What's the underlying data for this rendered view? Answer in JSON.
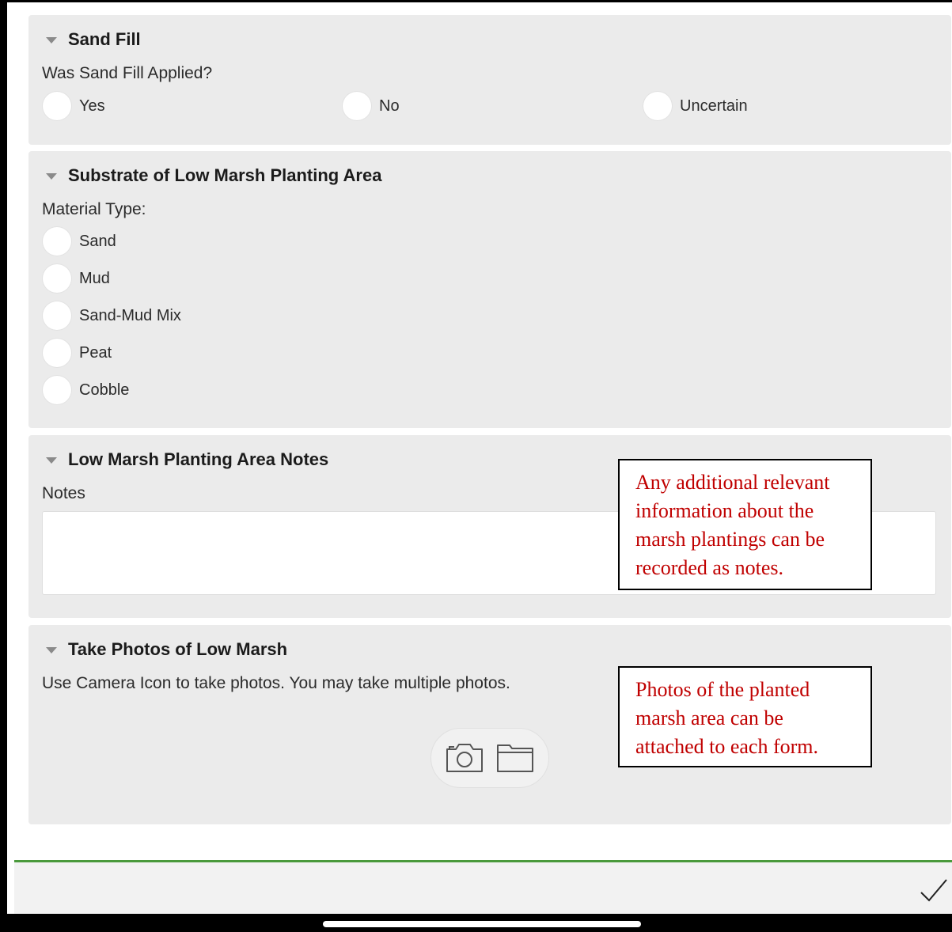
{
  "sections": {
    "sand_fill": {
      "title": "Sand Fill",
      "question": "Was Sand Fill Applied?",
      "options": [
        "Yes",
        "No",
        "Uncertain"
      ]
    },
    "substrate": {
      "title": "Substrate of Low Marsh Planting Area",
      "question": "Material Type:",
      "options": [
        "Sand",
        "Mud",
        "Sand-Mud Mix",
        "Peat",
        "Cobble"
      ]
    },
    "notes": {
      "title": "Low Marsh Planting Area Notes",
      "label": "Notes",
      "value": ""
    },
    "photos": {
      "title": "Take Photos of Low Marsh",
      "instruction": "Use Camera Icon to take photos. You may take multiple photos.",
      "icons": [
        "camera-icon",
        "folder-icon"
      ]
    }
  },
  "callouts": {
    "notes": "Any additional relevant information about the marsh plantings can be recorded as notes.",
    "photos": "Photos of the planted marsh area can be attached to each form."
  },
  "footer": {
    "submit_icon": "checkmark-icon"
  },
  "colors": {
    "section_bg": "#ebebeb",
    "accent_green": "#4a9a3c",
    "callout_text": "#c00000"
  }
}
